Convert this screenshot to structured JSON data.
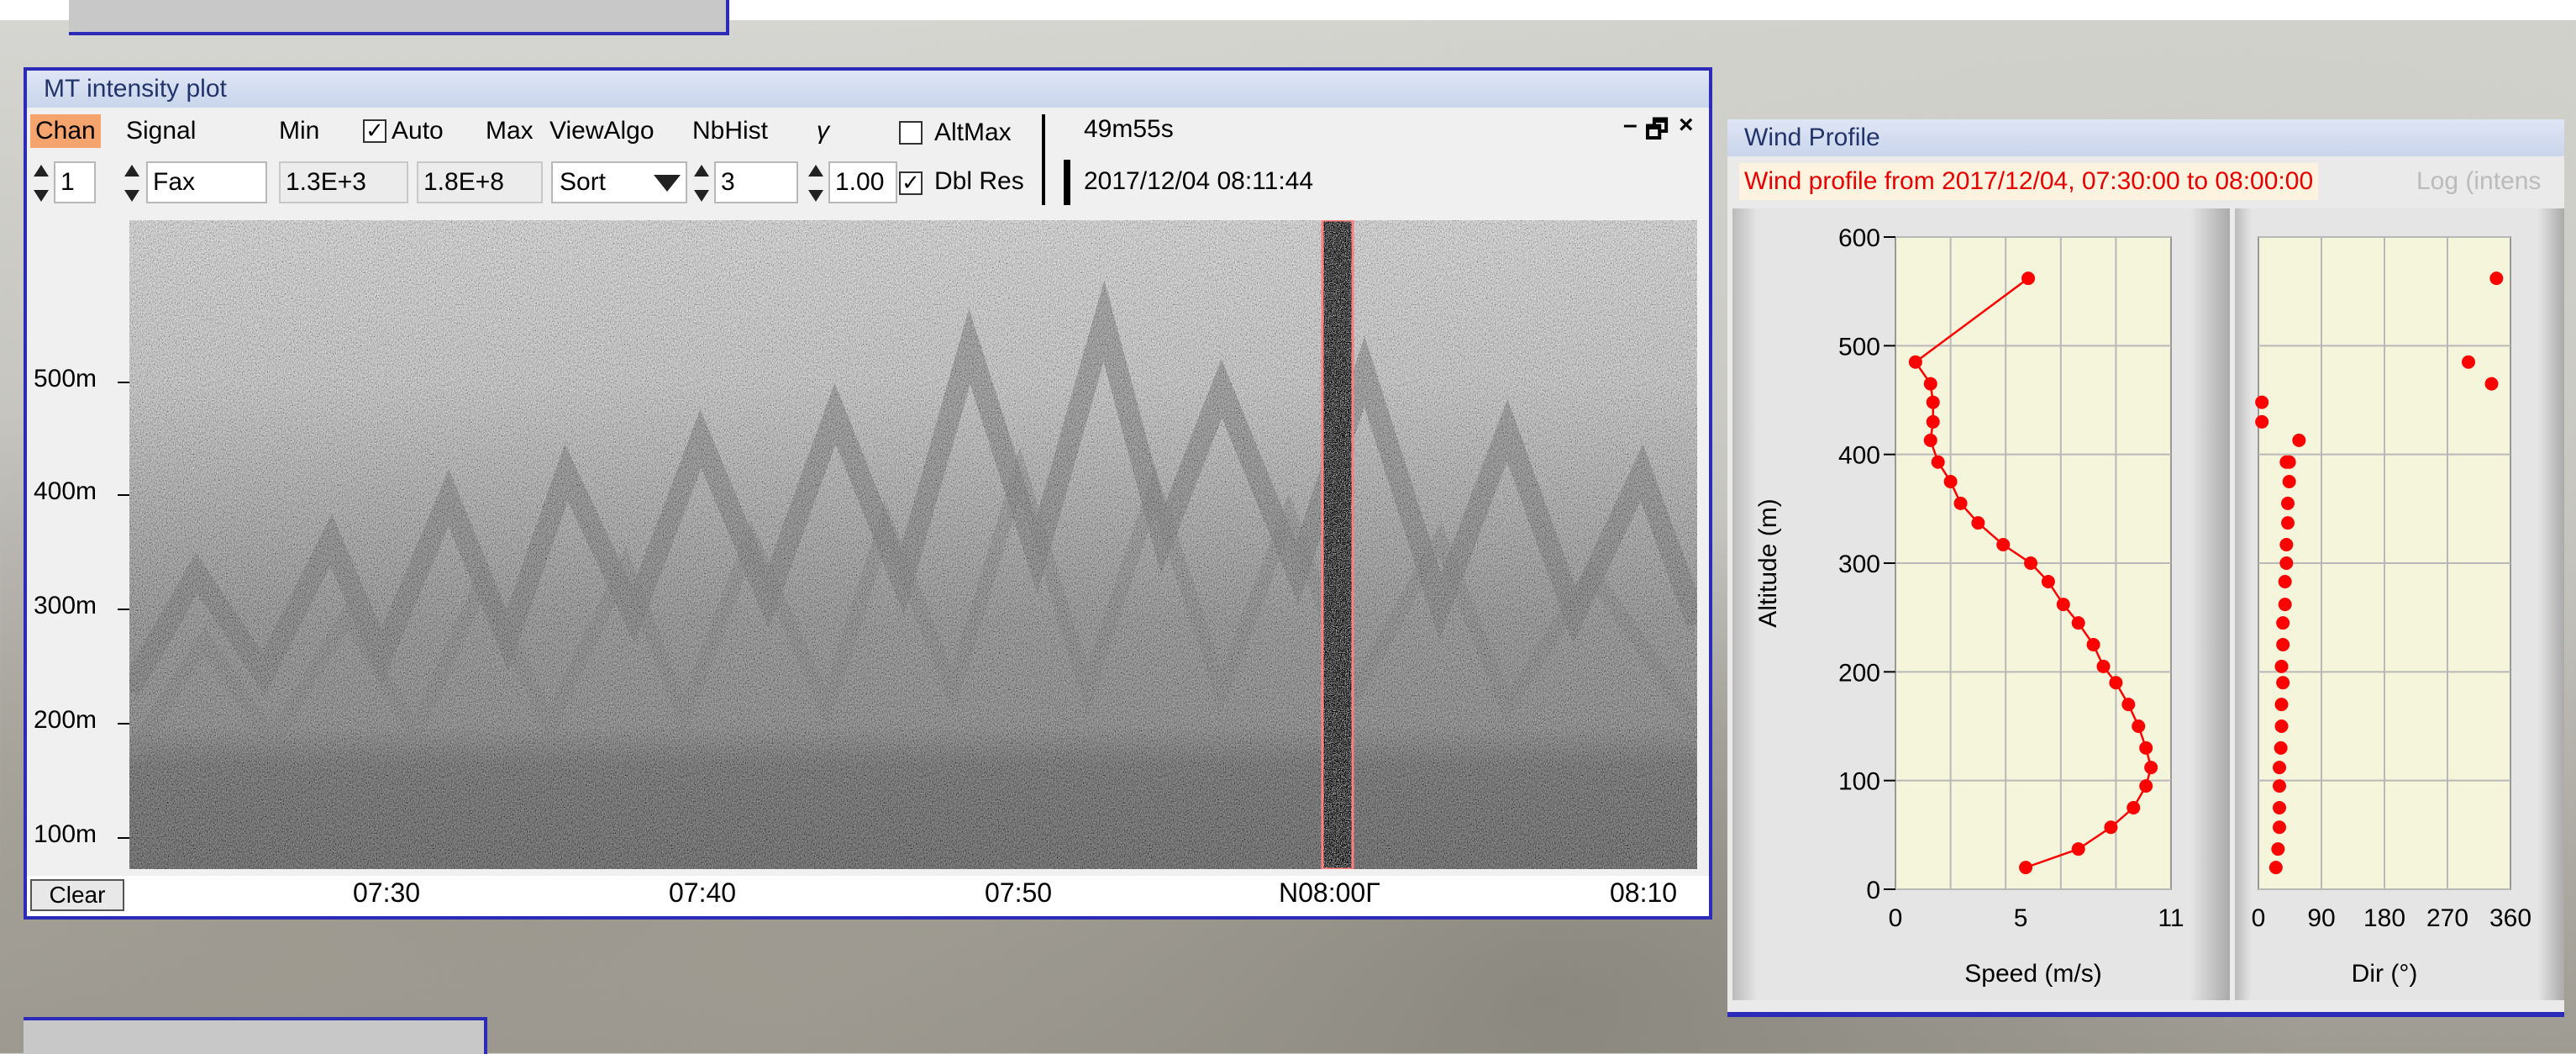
{
  "mt_window": {
    "title": "MT intensity plot",
    "controls": {
      "chan_label": "Chan",
      "chan_value": "1",
      "signal_label": "Signal",
      "signal_value": "Fax",
      "min_label": "Min",
      "min_value": "1.3E+3",
      "auto_label": "Auto",
      "auto_checked": "✓",
      "max_label": "Max",
      "max_value": "1.8E+8",
      "viewalgo_label": "ViewAlgo",
      "viewalgo_value": "Sort",
      "nbhist_label": "NbHist",
      "nbhist_value": "3",
      "gamma_label": "γ",
      "gamma_value": "1.00",
      "altmax_label": "AltMax",
      "altmax_checked": "",
      "dblres_label": "Dbl Res",
      "dblres_checked": "✓"
    },
    "duration": "49m55s",
    "timestamp": "2017/12/04 08:11:44",
    "window_controls": {
      "minimize": "–",
      "restore": "🗗",
      "close": "×"
    },
    "y_axis_labels": [
      "100m",
      "200m",
      "300m",
      "400m",
      "500m"
    ],
    "x_axis_labels": [
      "07:30",
      "07:40",
      "07:50",
      "08:00",
      "08:10"
    ],
    "x_axis_cursor_label": "N08:00Γ",
    "clear_button": "Clear"
  },
  "wind_window": {
    "title": "Wind Profile",
    "range_text": "Wind profile from 2017/12/04, 07:30:00 to 08:00:00",
    "log_text": "Log (intens",
    "colors": {
      "marker": "#ff0000",
      "plot_bg": "#f5f5dc",
      "grid": "#b8b8b8"
    }
  },
  "chart_data": [
    {
      "type": "line",
      "title": "",
      "xlabel": "Speed (m/s)",
      "ylabel": "Altitude (m)",
      "xlim": [
        0,
        11
      ],
      "ylim": [
        0,
        600
      ],
      "x_ticks": [
        "0",
        "5",
        "11"
      ],
      "y_ticks": [
        "0",
        "100",
        "200",
        "300",
        "400",
        "500",
        "600"
      ],
      "grid": true,
      "series": [
        {
          "x": [
            5.2,
            7.3,
            8.6,
            9.5,
            10.0,
            10.2,
            10.0,
            9.7,
            9.3,
            8.8,
            8.3,
            7.9,
            7.3,
            6.7,
            6.1,
            5.4,
            4.3,
            3.3,
            2.6,
            2.2,
            1.7,
            1.4,
            1.5,
            1.5,
            1.4,
            0.8,
            5.3
          ],
          "y": [
            20,
            37,
            57,
            75,
            95,
            112,
            130,
            150,
            170,
            190,
            205,
            225,
            245,
            262,
            283,
            300,
            317,
            337,
            355,
            375,
            393,
            413,
            430,
            448,
            465,
            485,
            562
          ]
        }
      ]
    },
    {
      "type": "scatter",
      "title": "",
      "xlabel": "Dir (°)",
      "ylabel": "",
      "xlim": [
        0,
        360
      ],
      "ylim": [
        0,
        600
      ],
      "x_ticks": [
        "0",
        "90",
        "180",
        "270",
        "360"
      ],
      "y_ticks": [],
      "grid": true,
      "series": [
        {
          "x": [
            25,
            28,
            30,
            30,
            30,
            30,
            32,
            33,
            33,
            35,
            33,
            35,
            35,
            38,
            38,
            40,
            40,
            42,
            42,
            44,
            44,
            40,
            58,
            5,
            5,
            333,
            300,
            340
          ],
          "y": [
            20,
            37,
            57,
            75,
            95,
            112,
            130,
            150,
            170,
            190,
            205,
            225,
            245,
            262,
            283,
            300,
            317,
            337,
            355,
            375,
            393,
            393,
            413,
            430,
            448,
            465,
            485,
            562
          ]
        }
      ]
    }
  ]
}
